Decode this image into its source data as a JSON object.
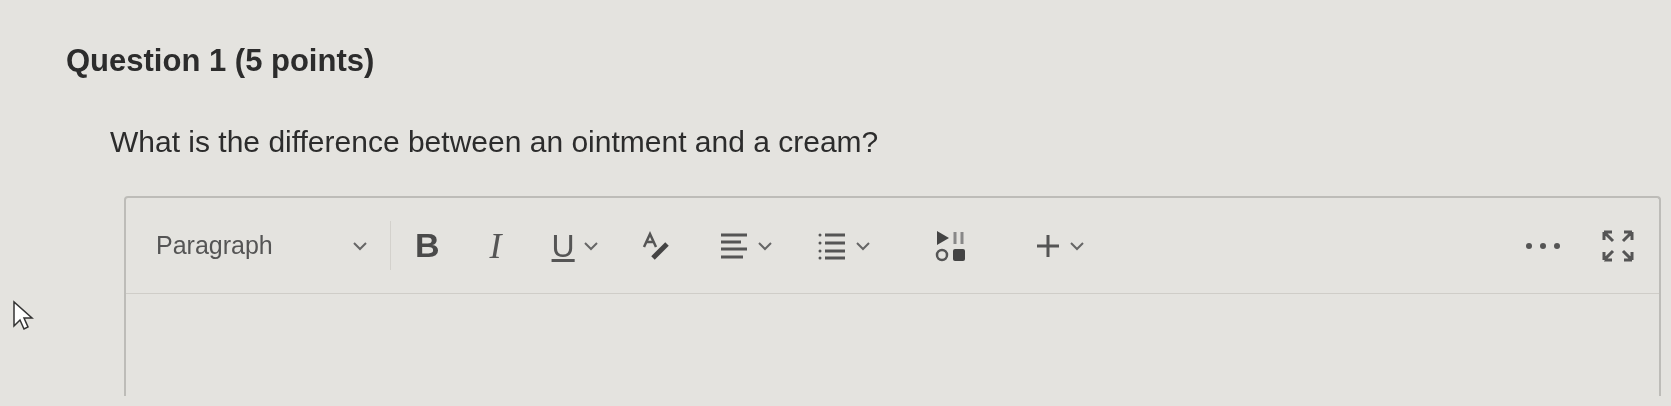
{
  "question": {
    "title": "Question 1 (5 points)",
    "prompt": "What is the difference between an ointment and a cream?"
  },
  "editor": {
    "toolbar": [
      {
        "kind": "format",
        "label": "Paragraph",
        "menu": true
      },
      {
        "kind": "bold",
        "label": "B",
        "menu": false
      },
      {
        "kind": "italic",
        "label": "I",
        "menu": false
      },
      {
        "kind": "underline",
        "label": "U",
        "menu": true
      },
      {
        "kind": "text-style",
        "menu": false
      },
      {
        "kind": "align",
        "menu": true
      },
      {
        "kind": "list",
        "menu": true
      },
      {
        "kind": "media",
        "menu": false
      },
      {
        "kind": "insert",
        "menu": true
      },
      {
        "kind": "more",
        "menu": false
      },
      {
        "kind": "fullscreen",
        "menu": false
      }
    ]
  }
}
